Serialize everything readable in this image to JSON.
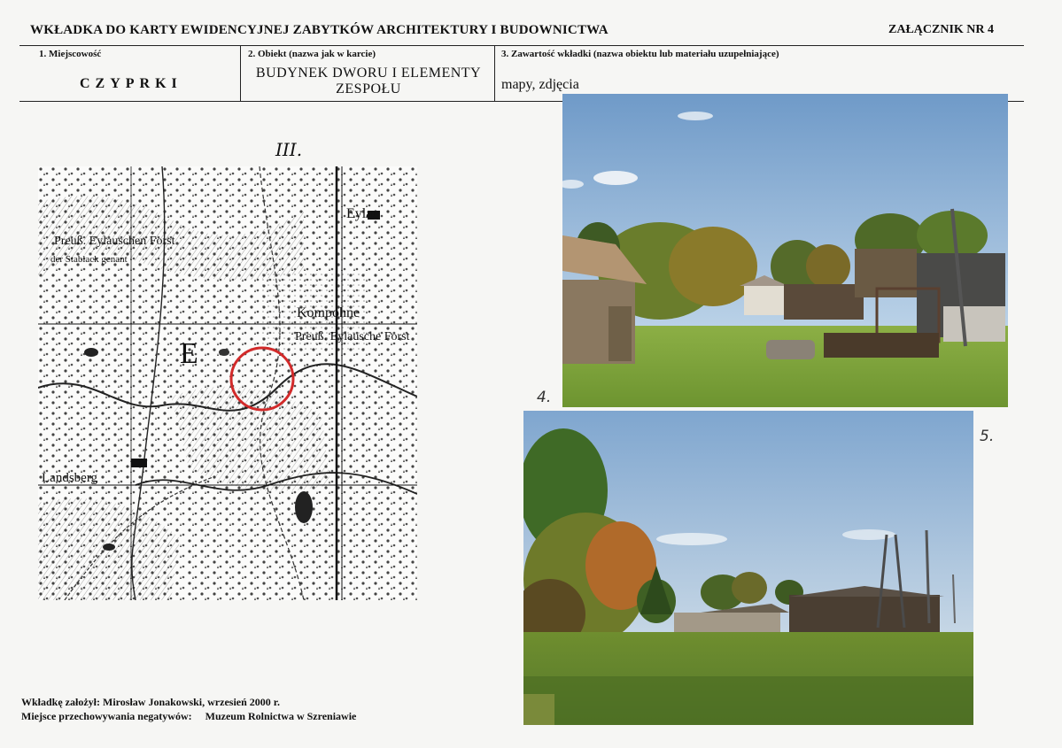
{
  "header": {
    "title": "WKŁADKA DO KARTY EWIDENCYJNEJ ZABYTKÓW ARCHITEKTURY I BUDOWNICTWA",
    "attachment": "ZAŁĄCZNIK NR 4"
  },
  "fields": {
    "place_label": "1. Miejscowość",
    "place_value": "CZYPRKI",
    "object_label": "2. Obiekt (nazwa jak w karcie)",
    "object_value": "BUDYNEK DWORU I ELEMENTY ZESPOŁU",
    "content_label": "3. Zawartość wkładki (nazwa obiektu lub materiału uzupełniające)",
    "content_value": "mapy, zdjęcia"
  },
  "map": {
    "number": "III.",
    "labels": {
      "forest": "Preuß. Eylauschen Forst",
      "stablack": "der Stablack genant",
      "kompohne": "Kompohne",
      "preuss_eylau": "Preuß. Eylausche Forst",
      "landsberg": "Landsberg",
      "eylau": "Eylau",
      "big_letter": "E"
    }
  },
  "photos": [
    {
      "number": "4."
    },
    {
      "number": "5."
    }
  ],
  "footer": {
    "author_label": "Wkładkę założył:",
    "author_value": "Mirosław Jonakowski, wrzesień  2000 r.",
    "storage_label": "Miejsce przechowywania negatywów:",
    "storage_value": "Muzeum Rolnictwa w Szreniawie"
  },
  "colors": {
    "marker": "#d22a2a",
    "sky": "#8fb4d8",
    "grass": "#7fa43a"
  }
}
